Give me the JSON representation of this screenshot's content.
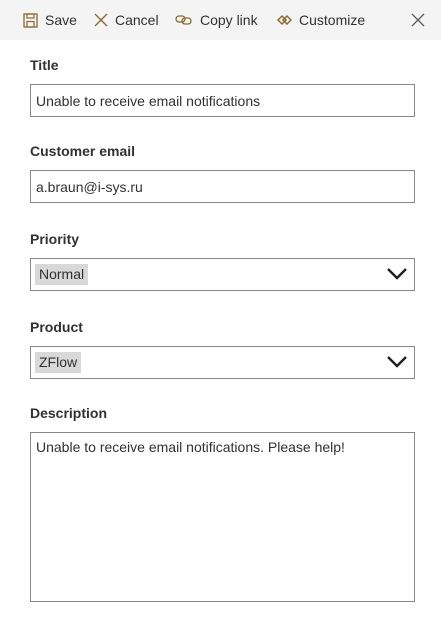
{
  "toolbar": {
    "save_label": "Save",
    "cancel_label": "Cancel",
    "copy_link_label": "Copy link",
    "customize_label": "Customize"
  },
  "form": {
    "title": {
      "label": "Title",
      "value": "Unable to receive email notifications"
    },
    "customer_email": {
      "label": "Customer email",
      "value": "a.braun@i-sys.ru"
    },
    "priority": {
      "label": "Priority",
      "value": "Normal"
    },
    "product": {
      "label": "Product",
      "value": "ZFlow"
    },
    "description": {
      "label": "Description",
      "value": "Unable to receive email notifications. Please help!"
    }
  },
  "colors": {
    "toolbar_bg": "#f4f4f4",
    "icon_accent": "#8a6a2f",
    "border": "#8a8886",
    "chip_bg": "#d8d8d8"
  }
}
